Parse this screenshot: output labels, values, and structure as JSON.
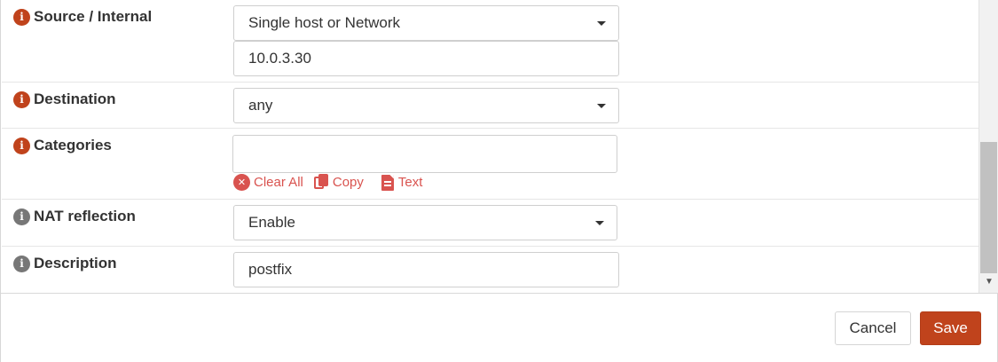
{
  "form": {
    "source": {
      "label": "Source / Internal",
      "select_value": "Single host or Network",
      "input_value": "10.0.3.30"
    },
    "destination": {
      "label": "Destination",
      "select_value": "any"
    },
    "categories": {
      "label": "Categories",
      "input_value": "",
      "actions": {
        "clear_all": "Clear All",
        "copy": "Copy",
        "text": "Text"
      }
    },
    "nat_reflection": {
      "label": "NAT reflection",
      "select_value": "Enable"
    },
    "description": {
      "label": "Description",
      "input_value": "postfix"
    }
  },
  "footer": {
    "cancel_label": "Cancel",
    "save_label": "Save"
  },
  "colors": {
    "accent": "#c0431c",
    "action_red": "#d9534f",
    "info_grey": "#777777"
  },
  "icons": {
    "info": "info-icon",
    "clear": "x-circle-icon",
    "copy": "copy-icon",
    "text": "file-text-icon",
    "dropdown": "caret-down-icon"
  }
}
